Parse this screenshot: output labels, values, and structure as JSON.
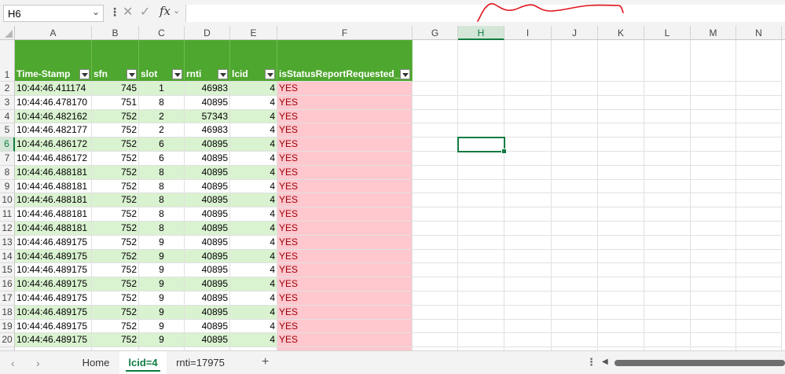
{
  "formula_bar": {
    "name_box": "H6",
    "formula": "",
    "fx_label": "fx"
  },
  "columns": [
    "A",
    "B",
    "C",
    "D",
    "E",
    "F",
    "G",
    "H",
    "I",
    "J",
    "K",
    "L",
    "M",
    "N"
  ],
  "selected_column": "H",
  "selected_row": 6,
  "header_row": {
    "row_number": "1",
    "labels": [
      "Time-Stamp",
      "sfn",
      "slot",
      "rnti",
      "lcid",
      "isStatusReportRequested_"
    ]
  },
  "rows": [
    {
      "n": "2",
      "ts": "10:44:46.411174",
      "sfn": "745",
      "slot": "1",
      "rnti": "46983",
      "lcid": "4",
      "req": "YES"
    },
    {
      "n": "3",
      "ts": "10:44:46.478170",
      "sfn": "751",
      "slot": "8",
      "rnti": "40895",
      "lcid": "4",
      "req": "YES"
    },
    {
      "n": "4",
      "ts": "10:44:46.482162",
      "sfn": "752",
      "slot": "2",
      "rnti": "57343",
      "lcid": "4",
      "req": "YES"
    },
    {
      "n": "5",
      "ts": "10:44:46.482177",
      "sfn": "752",
      "slot": "2",
      "rnti": "46983",
      "lcid": "4",
      "req": "YES"
    },
    {
      "n": "6",
      "ts": "10:44:46.486172",
      "sfn": "752",
      "slot": "6",
      "rnti": "40895",
      "lcid": "4",
      "req": "YES"
    },
    {
      "n": "7",
      "ts": "10:44:46.486172",
      "sfn": "752",
      "slot": "6",
      "rnti": "40895",
      "lcid": "4",
      "req": "YES"
    },
    {
      "n": "8",
      "ts": "10:44:46.488181",
      "sfn": "752",
      "slot": "8",
      "rnti": "40895",
      "lcid": "4",
      "req": "YES"
    },
    {
      "n": "9",
      "ts": "10:44:46.488181",
      "sfn": "752",
      "slot": "8",
      "rnti": "40895",
      "lcid": "4",
      "req": "YES"
    },
    {
      "n": "10",
      "ts": "10:44:46.488181",
      "sfn": "752",
      "slot": "8",
      "rnti": "40895",
      "lcid": "4",
      "req": "YES"
    },
    {
      "n": "11",
      "ts": "10:44:46.488181",
      "sfn": "752",
      "slot": "8",
      "rnti": "40895",
      "lcid": "4",
      "req": "YES"
    },
    {
      "n": "12",
      "ts": "10:44:46.488181",
      "sfn": "752",
      "slot": "8",
      "rnti": "40895",
      "lcid": "4",
      "req": "YES"
    },
    {
      "n": "13",
      "ts": "10:44:46.489175",
      "sfn": "752",
      "slot": "9",
      "rnti": "40895",
      "lcid": "4",
      "req": "YES"
    },
    {
      "n": "14",
      "ts": "10:44:46.489175",
      "sfn": "752",
      "slot": "9",
      "rnti": "40895",
      "lcid": "4",
      "req": "YES"
    },
    {
      "n": "15",
      "ts": "10:44:46.489175",
      "sfn": "752",
      "slot": "9",
      "rnti": "40895",
      "lcid": "4",
      "req": "YES"
    },
    {
      "n": "16",
      "ts": "10:44:46.489175",
      "sfn": "752",
      "slot": "9",
      "rnti": "40895",
      "lcid": "4",
      "req": "YES"
    },
    {
      "n": "17",
      "ts": "10:44:46.489175",
      "sfn": "752",
      "slot": "9",
      "rnti": "40895",
      "lcid": "4",
      "req": "YES"
    },
    {
      "n": "18",
      "ts": "10:44:46.489175",
      "sfn": "752",
      "slot": "9",
      "rnti": "40895",
      "lcid": "4",
      "req": "YES"
    },
    {
      "n": "19",
      "ts": "10:44:46.489175",
      "sfn": "752",
      "slot": "9",
      "rnti": "40895",
      "lcid": "4",
      "req": "YES"
    },
    {
      "n": "20",
      "ts": "10:44:46.489175",
      "sfn": "752",
      "slot": "9",
      "rnti": "40895",
      "lcid": "4",
      "req": "YES"
    }
  ],
  "sheet_tabs": [
    {
      "label": "Home",
      "active": false
    },
    {
      "label": "lcid=4",
      "active": true
    },
    {
      "label": "rnti=17975",
      "active": false
    }
  ],
  "colors": {
    "header_green": "#4ea72e",
    "band_green": "#d9f2d0",
    "status_pink": "#ffc7ce",
    "status_text": "#9c0006",
    "excel_accent": "#107c41",
    "scribble_red": "#e0141e"
  },
  "icons": [
    "chevron-down-icon",
    "more-dots-icon",
    "cancel-icon",
    "enter-icon",
    "function-icon",
    "filter-dropdown-icon",
    "nav-left-icon",
    "nav-right-icon",
    "add-sheet-icon"
  ]
}
